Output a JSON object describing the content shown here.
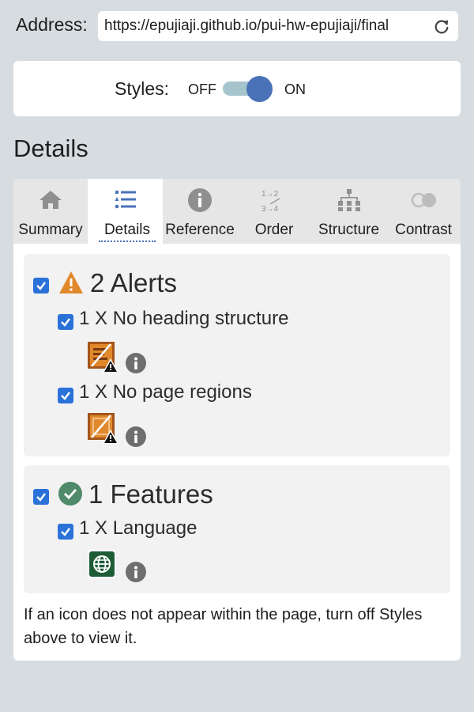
{
  "address": {
    "label": "Address:",
    "url": "https://epujiaji.github.io/pui-hw-epujiaji/final"
  },
  "styles": {
    "label": "Styles:",
    "off_label": "OFF",
    "on_label": "ON",
    "state": "on"
  },
  "section_title": "Details",
  "tabs": [
    {
      "label": "Summary",
      "icon": "home-icon",
      "active": false
    },
    {
      "label": "Details",
      "icon": "list-icon",
      "active": true
    },
    {
      "label": "Reference",
      "icon": "info-icon",
      "active": false
    },
    {
      "label": "Order",
      "icon": "order-icon",
      "active": false
    },
    {
      "label": "Structure",
      "icon": "structure-icon",
      "active": false
    },
    {
      "label": "Contrast",
      "icon": "contrast-icon",
      "active": false
    }
  ],
  "alerts": {
    "title": "2 Alerts",
    "icon": "warning-icon",
    "checked": true,
    "items": [
      {
        "label": "1 X No heading structure",
        "icon": "no-heading-icon",
        "checked": true
      },
      {
        "label": "1 X No page regions",
        "icon": "no-regions-icon",
        "checked": true
      }
    ]
  },
  "features": {
    "title": "1 Features",
    "icon": "check-circle-icon",
    "checked": true,
    "items": [
      {
        "label": "1 X Language",
        "icon": "language-icon",
        "checked": true
      }
    ]
  },
  "note": "If an icon does not appear within the page, turn off Styles above to view it.",
  "colors": {
    "background": "#d7dce0",
    "checkbox": "#2a72d8",
    "toggle_knob": "#4a72b8",
    "toggle_track": "#a6c4cb",
    "warning": "#e0892c",
    "feature_check": "#4f8a6a",
    "language_icon": "#1e5c38"
  }
}
